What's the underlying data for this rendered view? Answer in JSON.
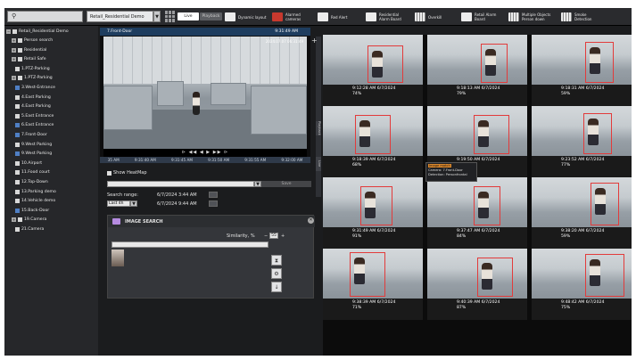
{
  "toolbar": {
    "search_placeholder": "",
    "site_select": "Retail_Residential Demo",
    "live_label": "Live",
    "playback_label": "Playback",
    "buttons": [
      {
        "label": "Dynamic layout",
        "icon": "layout-icon"
      },
      {
        "label": "Alarmed cameras",
        "icon": "alarm-icon"
      },
      {
        "label": "Red Alert",
        "icon": "alert-icon"
      },
      {
        "label": "Residential Alarm Board",
        "icon": "board-icon"
      },
      {
        "label": "Overkill",
        "icon": "grid-icon"
      },
      {
        "label": "Retail Alarm Board",
        "icon": "board-icon"
      },
      {
        "label": "Multiple Objects Person down",
        "icon": "grid-icon"
      },
      {
        "label": "Smoke Detection",
        "icon": "grid-icon"
      }
    ]
  },
  "tree": {
    "root": "Retail_Residential Demo",
    "items": [
      {
        "label": "Person search",
        "type": "group"
      },
      {
        "label": "Residential",
        "type": "group"
      },
      {
        "label": "Retail Safe",
        "type": "group"
      },
      {
        "label": "1.PTZ-Parking",
        "type": "camera"
      },
      {
        "label": "1.PTZ-Parking",
        "type": "group"
      },
      {
        "label": "3.West-Entrance",
        "type": "camera-checked"
      },
      {
        "label": "4.East Parking",
        "type": "camera"
      },
      {
        "label": "4.East Parking",
        "type": "camera"
      },
      {
        "label": "5.East Entrance",
        "type": "camera"
      },
      {
        "label": "6.East Entrance",
        "type": "camera-checked"
      },
      {
        "label": "7.Front-Door",
        "type": "camera-checked"
      },
      {
        "label": "9.West Parking",
        "type": "camera"
      },
      {
        "label": "9.West Parking",
        "type": "camera-checked"
      },
      {
        "label": "10.Airport",
        "type": "camera"
      },
      {
        "label": "11.Food court",
        "type": "camera"
      },
      {
        "label": "12.Top-Down",
        "type": "camera"
      },
      {
        "label": "13.Parking demo",
        "type": "camera"
      },
      {
        "label": "14.Vehicle demo",
        "type": "camera"
      },
      {
        "label": "15.Back-Door",
        "type": "camera-checked"
      },
      {
        "label": "19.Camera",
        "type": "group"
      },
      {
        "label": "21.Camera",
        "type": "camera"
      }
    ]
  },
  "player": {
    "title": "7.Front-Door",
    "time": "9:31:49 AM",
    "overlay_date": "2024.07.07 06:31:49",
    "controls": "⊳ ◀◀ ◀ ▶ ▶▶ ⊳",
    "timeline": [
      "35 AM",
      "9:31:40 AM",
      "9:31:45 AM",
      "9:31:50 AM",
      "9:31:55 AM",
      "9:32:00 AM"
    ]
  },
  "controls": {
    "show_heatmap": "Show HeatMap",
    "save": "Save",
    "search_range_label": "Search range:",
    "range_from": "6/7/2024 3:44 AM",
    "range_unit": "Last 4h",
    "range_to": "6/7/2024 9:44 AM"
  },
  "image_search": {
    "title": "IMAGE SEARCH",
    "similarity_label": "Similarity, %",
    "similarity_value": "55"
  },
  "results": [
    {
      "time": "9:12:28 AM 6/7/2024",
      "score": "74%"
    },
    {
      "time": "9:18:13 AM 6/7/2024",
      "score": "79%"
    },
    {
      "time": "9:18:31 AM 6/7/2024",
      "score": "59%"
    },
    {
      "time": "9:18:39 AM 6/7/2024",
      "score": "68%"
    },
    {
      "time": "9:19:50 AM 6/7/2024",
      "score": "69%"
    },
    {
      "time": "9:23:52 AM 6/7/2024",
      "score": "77%"
    },
    {
      "time": "9:31:49 AM 6/7/2024",
      "score": "91%"
    },
    {
      "time": "9:37:47 AM 6/7/2024",
      "score": "84%"
    },
    {
      "time": "9:38:20 AM 6/7/2024",
      "score": "59%"
    },
    {
      "time": "9:38:39 AM 6/7/2024",
      "score": "71%"
    },
    {
      "time": "9:40:39 AM 6/7/2024",
      "score": "87%"
    },
    {
      "time": "9:48:42 AM 6/7/2024",
      "score": "75%"
    }
  ],
  "tooltip": {
    "title": "Image match",
    "camera": "Camera: 7.Front-Door",
    "detection": "Detection: Personfrontal"
  },
  "side_tabs": [
    "Playback",
    "Live"
  ]
}
